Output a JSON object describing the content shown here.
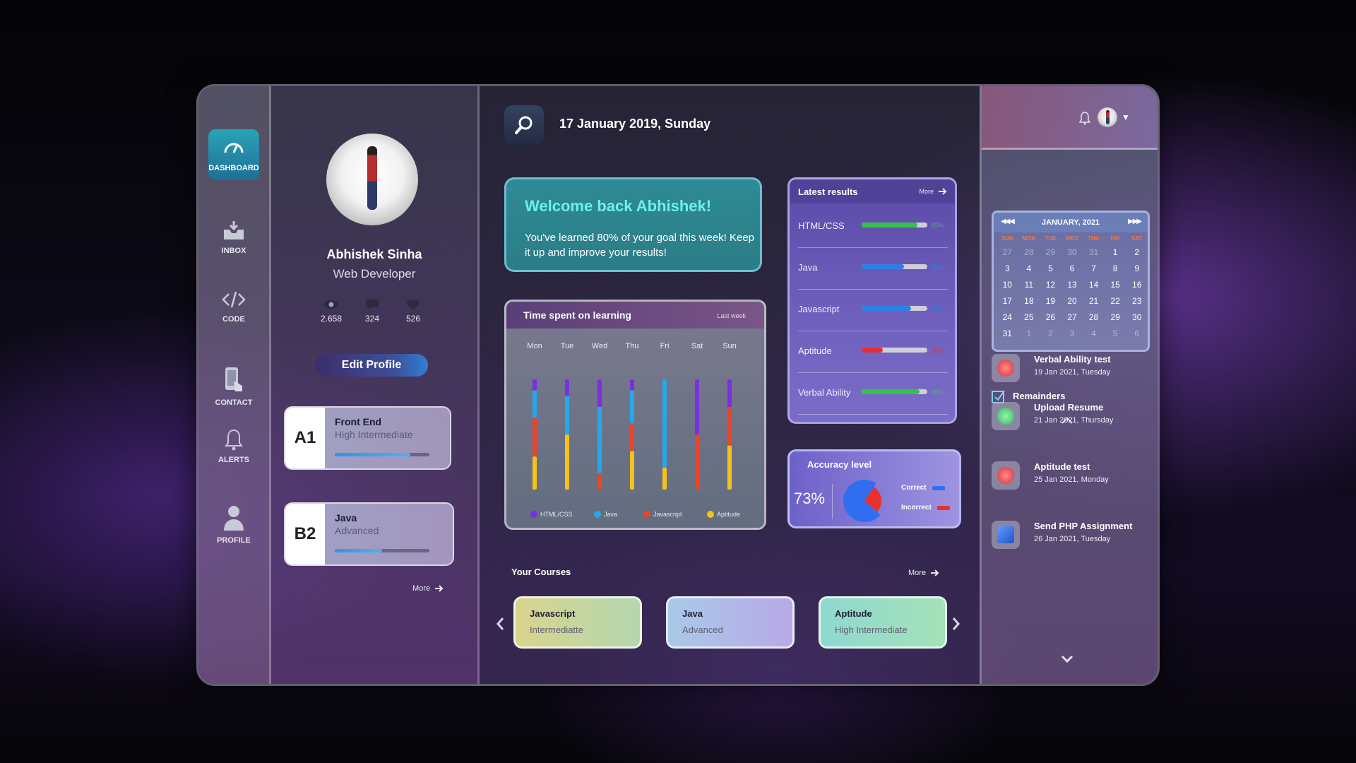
{
  "nav": {
    "items": [
      {
        "label": "DASHBOARD",
        "icon": "speedometer-icon",
        "active": true
      },
      {
        "label": "INBOX",
        "icon": "inbox-icon",
        "active": false
      },
      {
        "label": "CODE",
        "icon": "code-icon",
        "active": false
      },
      {
        "label": "CONTACT",
        "icon": "phone-touch-icon",
        "active": false
      },
      {
        "label": "ALERTS",
        "icon": "bell-icon",
        "active": false
      },
      {
        "label": "PROFILE",
        "icon": "user-icon",
        "active": false
      }
    ]
  },
  "profile": {
    "name": "Abhishek Sinha",
    "role": "Web Developer",
    "stats": {
      "views": "2.658",
      "messages": "324",
      "likes": "526"
    },
    "edit_label": "Edit Profile",
    "levels": [
      {
        "badge": "A1",
        "title": "Front End",
        "subtitle": "High Intermediate",
        "progress": 0.8
      },
      {
        "badge": "B2",
        "title": "Java",
        "subtitle": "Advanced",
        "progress": 0.5
      }
    ],
    "more_label": "More"
  },
  "header": {
    "date": "17 January 2019, Sunday"
  },
  "welcome": {
    "title": "Welcome back Abhishek!",
    "message": "You've learned 80% of your goal this week! Keep it up and improve your results!"
  },
  "time_spent": {
    "title": "Time spent on learning",
    "period": "Last week",
    "legend": [
      "HTML/CSS",
      "Java",
      "Javascript",
      "Aptitude"
    ]
  },
  "chart_data": {
    "type": "bar",
    "stacked": true,
    "categories": [
      "Mon",
      "Tue",
      "Wed",
      "Thu",
      "Fri",
      "Sat",
      "Sun"
    ],
    "series": [
      {
        "name": "HTML/CSS",
        "color": "#7a2fe0",
        "values": [
          0.1,
          0.15,
          0.25,
          0.1,
          0.0,
          0.5,
          0.25
        ]
      },
      {
        "name": "Java",
        "color": "#25a8e8",
        "values": [
          0.25,
          0.35,
          0.6,
          0.3,
          0.8,
          0.0,
          0.0
        ]
      },
      {
        "name": "Javascript",
        "color": "#e8452a",
        "values": [
          0.35,
          0.0,
          0.15,
          0.25,
          0.0,
          0.5,
          0.35
        ]
      },
      {
        "name": "Aptitude",
        "color": "#f4c21c",
        "values": [
          0.3,
          0.5,
          0.0,
          0.35,
          0.2,
          0.0,
          0.4
        ]
      }
    ]
  },
  "results": {
    "title": "Latest results",
    "more_label": "More",
    "items": [
      {
        "label": "HTML/CSS",
        "value": 0.85,
        "pct": "85%",
        "color": "#36c24a"
      },
      {
        "label": "Java",
        "value": 0.65,
        "pct": "65%",
        "color": "#2f7ee8"
      },
      {
        "label": "Javascript",
        "value": 0.75,
        "pct": "75%",
        "color": "#2f7ee8"
      },
      {
        "label": "Aptitude",
        "value": 0.32,
        "pct": "32%",
        "color": "#e82f2f"
      },
      {
        "label": "Verbal Ability",
        "value": 0.88,
        "pct": "88%",
        "color": "#36c24a"
      }
    ]
  },
  "accuracy": {
    "title": "Accuracy level",
    "value": "73%",
    "correct_fraction": 0.73,
    "correct_label": "Correct",
    "incorrect_label": "Incorrect",
    "correct_color": "#2f6ef0",
    "incorrect_color": "#e8302f"
  },
  "courses": {
    "title": "Your Courses",
    "more_label": "More",
    "items": [
      {
        "title": "Javascript",
        "level": "Intermediatte"
      },
      {
        "title": "Java",
        "level": "Advanced"
      },
      {
        "title": "Aptitude",
        "level": "High Intermediate"
      }
    ]
  },
  "calendar": {
    "title": "JANUARY, 2021",
    "weekdays": [
      "SUN",
      "MON",
      "TUE",
      "WED",
      "THU",
      "FRI",
      "SAT"
    ],
    "prev_month_days": [
      "27",
      "28",
      "29",
      "30",
      "31"
    ],
    "days": [
      "1",
      "2",
      "3",
      "4",
      "5",
      "6",
      "7",
      "8",
      "9",
      "10",
      "11",
      "12",
      "13",
      "14",
      "15",
      "16",
      "17",
      "18",
      "19",
      "20",
      "21",
      "22",
      "23",
      "24",
      "25",
      "26",
      "27",
      "28",
      "29",
      "30",
      "31"
    ],
    "next_month_days": [
      "1",
      "2",
      "3",
      "4",
      "5",
      "6"
    ]
  },
  "reminders": {
    "title": "Remainders",
    "items": [
      {
        "title": "Verbal Ability test",
        "date": "19 Jan 2021, Tuesday",
        "icon": "alert-red-icon"
      },
      {
        "title": "Upload Resume",
        "date": "21 Jan 2021, Thursday",
        "icon": "upload-green-icon"
      },
      {
        "title": "Aptitude test",
        "date": "25 Jan 2021, Monday",
        "icon": "alert-red-icon"
      },
      {
        "title": "Send PHP Assignment",
        "date": "26 Jan 2021, Tuesday",
        "icon": "mail-icon"
      }
    ]
  }
}
